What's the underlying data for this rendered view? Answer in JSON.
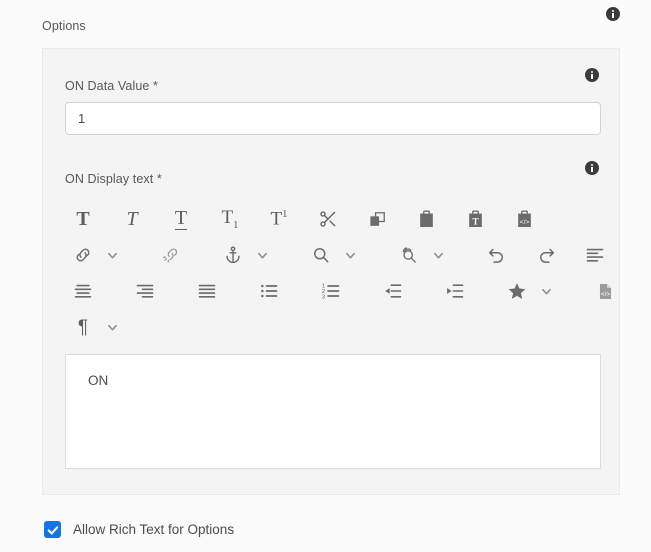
{
  "panel": {
    "section_label": "Options",
    "info_icon": "info-icon"
  },
  "fields": {
    "data_value": {
      "label": "ON Data Value *",
      "value": "1",
      "placeholder": ""
    },
    "display_text": {
      "label": "ON Display text *",
      "content": "ON"
    }
  },
  "rte_toolbar": {
    "rows": [
      [
        {
          "name": "bold-icon",
          "title": "Bold"
        },
        {
          "name": "italic-icon",
          "title": "Italic"
        },
        {
          "name": "underline-icon",
          "title": "Underline"
        },
        {
          "name": "subscript-icon",
          "title": "Subscript"
        },
        {
          "name": "superscript-icon",
          "title": "Superscript"
        },
        {
          "name": "cut-scissors-icon",
          "title": "Cut"
        },
        {
          "name": "copy-icon",
          "title": "Copy"
        },
        {
          "name": "paste-icon",
          "title": "Paste"
        },
        {
          "name": "paste-as-text-icon",
          "title": "Paste as text"
        },
        {
          "name": "paste-from-word-icon",
          "title": "Paste from Word"
        }
      ],
      [
        {
          "name": "link-icon",
          "title": "Hyperlink"
        },
        {
          "name": "chevron-down-icon",
          "title": "Hyperlink options"
        },
        {
          "name": "unlink-icon",
          "title": "Unlink"
        },
        {
          "name": "anchor-icon",
          "title": "Anchor"
        },
        {
          "name": "chevron-down-icon",
          "title": "Anchor options"
        },
        {
          "name": "find-icon",
          "title": "Find"
        },
        {
          "name": "chevron-down-icon",
          "title": "Find options"
        },
        {
          "name": "replace-icon",
          "title": "Replace"
        },
        {
          "name": "chevron-down-icon",
          "title": "Replace options"
        },
        {
          "name": "undo-icon",
          "title": "Undo"
        },
        {
          "name": "redo-icon",
          "title": "Redo"
        },
        {
          "name": "align-left-icon",
          "title": "Align left"
        }
      ],
      [
        {
          "name": "align-center-icon",
          "title": "Align center"
        },
        {
          "name": "align-right-icon",
          "title": "Align right"
        },
        {
          "name": "justify-icon",
          "title": "Justify"
        },
        {
          "name": "bulleted-list-icon",
          "title": "Bulleted list"
        },
        {
          "name": "numbered-list-icon",
          "title": "Numbered list"
        },
        {
          "name": "outdent-icon",
          "title": "Decrease indent"
        },
        {
          "name": "indent-icon",
          "title": "Increase indent"
        },
        {
          "name": "special-character-star-icon",
          "title": "Special character"
        },
        {
          "name": "chevron-down-icon",
          "title": "Special character options"
        },
        {
          "name": "source-code-icon",
          "title": "Source edit"
        }
      ],
      [
        {
          "name": "paragraph-format-icon",
          "title": "Paragraph format"
        },
        {
          "name": "chevron-down-icon",
          "title": "Paragraph format options"
        }
      ]
    ]
  },
  "checkbox": {
    "label": "Allow Rich Text for Options",
    "checked": true,
    "accent_color": "#1473e6"
  },
  "colors": {
    "page_background": "#fbfbfb",
    "card_background": "#f4f4f4",
    "input_background": "#ffffff",
    "text": "#4b4b4b",
    "label_text": "#575757",
    "icon": "#5e5e5e",
    "border": "#d3d3d3"
  }
}
